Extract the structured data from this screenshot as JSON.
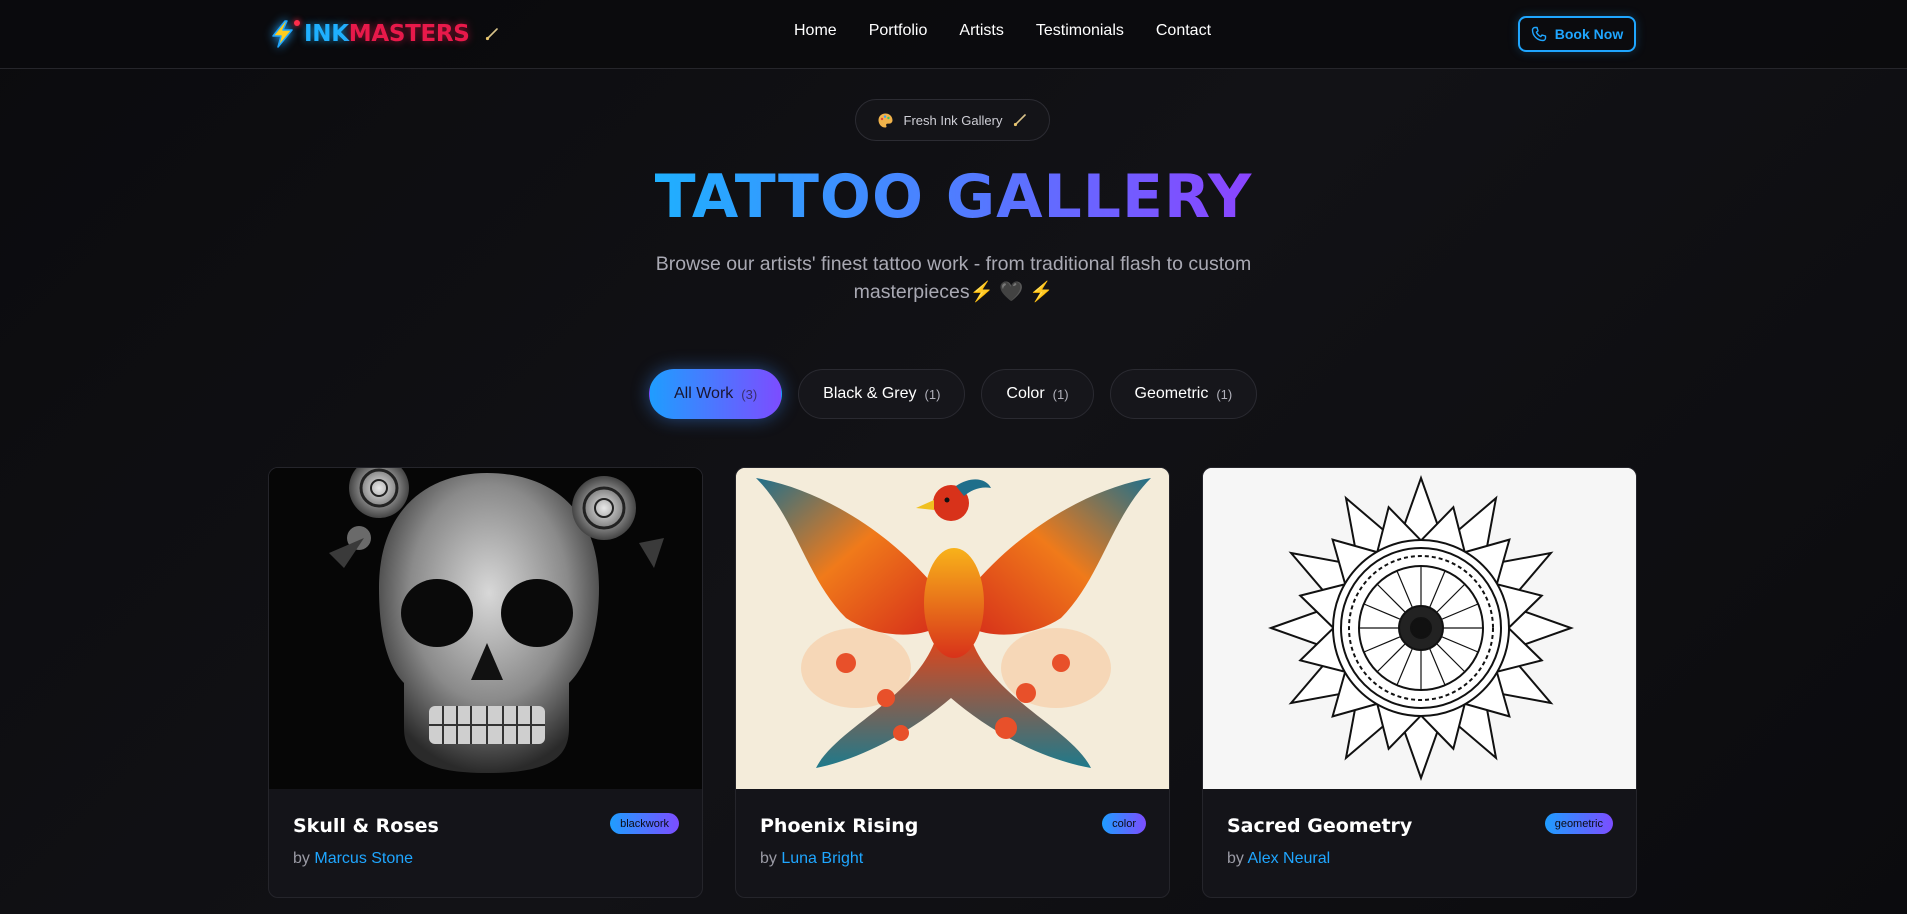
{
  "nav": {
    "logo_ink": "INK",
    "logo_masters": "MASTERS",
    "links": [
      "Home",
      "Portfolio",
      "Artists",
      "Testimonials",
      "Contact"
    ],
    "book_label": "Book Now"
  },
  "hero": {
    "badge": "Fresh Ink Gallery",
    "title": "TATTOO GALLERY",
    "subtitle_line1": "Browse our artists' finest tattoo work - from traditional flash to custom",
    "subtitle_line2": "masterpieces⚡ 🖤 ⚡"
  },
  "filters": [
    {
      "label": "All Work",
      "count": "(3)",
      "active": true
    },
    {
      "label": "Black & Grey",
      "count": "(1)",
      "active": false
    },
    {
      "label": "Color",
      "count": "(1)",
      "active": false
    },
    {
      "label": "Geometric",
      "count": "(1)",
      "active": false
    }
  ],
  "cards": [
    {
      "title": "Skull & Roses",
      "by": "by",
      "artist": "Marcus Stone",
      "tag": "blackwork",
      "image": "skull-roses-image"
    },
    {
      "title": "Phoenix Rising",
      "by": "by",
      "artist": "Luna Bright",
      "tag": "color",
      "image": "phoenix-image"
    },
    {
      "title": "Sacred Geometry",
      "by": "by",
      "artist": "Alex Neural",
      "tag": "geometric",
      "image": "mandala-image"
    }
  ],
  "colors": {
    "accent_blue": "#1fa6ff",
    "accent_purple": "#7c4dff",
    "accent_red": "#e8194a",
    "background": "#0d0d10"
  }
}
